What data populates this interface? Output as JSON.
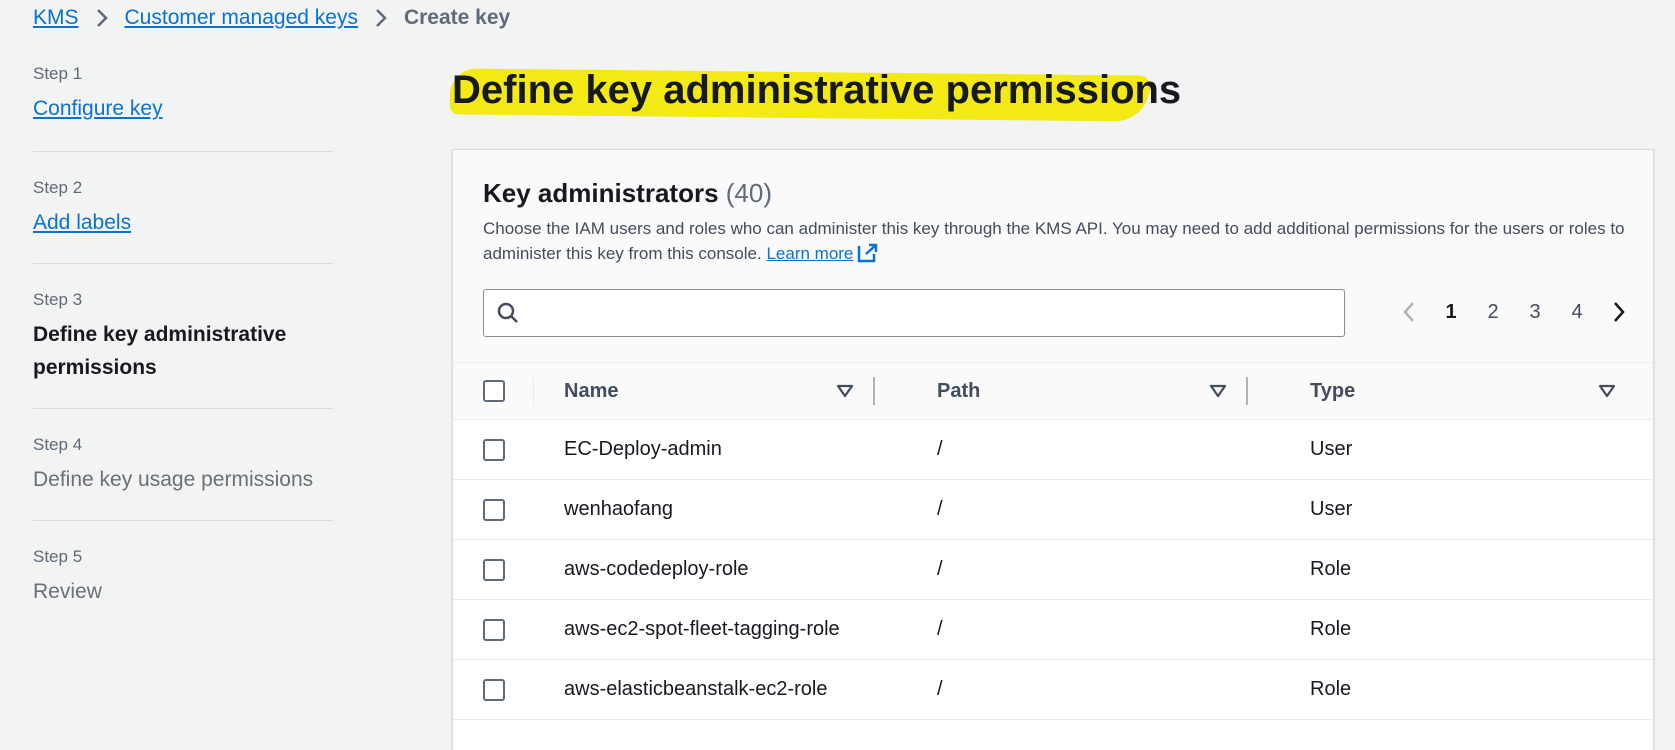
{
  "breadcrumb": {
    "items": [
      "KMS",
      "Customer managed keys"
    ],
    "current": "Create key"
  },
  "steps": [
    {
      "num": "Step 1",
      "title": "Configure key"
    },
    {
      "num": "Step 2",
      "title": "Add labels"
    },
    {
      "num": "Step 3",
      "title": "Define key administrative permissions"
    },
    {
      "num": "Step 4",
      "title": "Define key usage permissions"
    },
    {
      "num": "Step 5",
      "title": "Review"
    }
  ],
  "page": {
    "title": "Define key administrative permissions"
  },
  "panel": {
    "title": "Key administrators",
    "count": "(40)",
    "description": "Choose the IAM users and roles who can administer this key through the KMS API. You may need to add additional permissions for the users or roles to administer this key from this console.",
    "learn_more": "Learn more"
  },
  "search": {
    "value": "",
    "placeholder": ""
  },
  "pagination": {
    "pages": [
      "1",
      "2",
      "3",
      "4"
    ],
    "current": "1"
  },
  "table": {
    "columns": [
      "Name",
      "Path",
      "Type"
    ],
    "rows": [
      {
        "name": "EC-Deploy-admin",
        "path": "/",
        "type": "User"
      },
      {
        "name": "wenhaofang",
        "path": "/",
        "type": "User"
      },
      {
        "name": "aws-codedeploy-role",
        "path": "/",
        "type": "Role"
      },
      {
        "name": "aws-ec2-spot-fleet-tagging-role",
        "path": "/",
        "type": "Role"
      },
      {
        "name": "aws-elasticbeanstalk-ec2-role",
        "path": "/",
        "type": "Role"
      }
    ]
  },
  "colors": {
    "link": "#0972d3",
    "highlight": "#f3e914",
    "text": "#16191f",
    "muted": "#5f6b7a"
  }
}
